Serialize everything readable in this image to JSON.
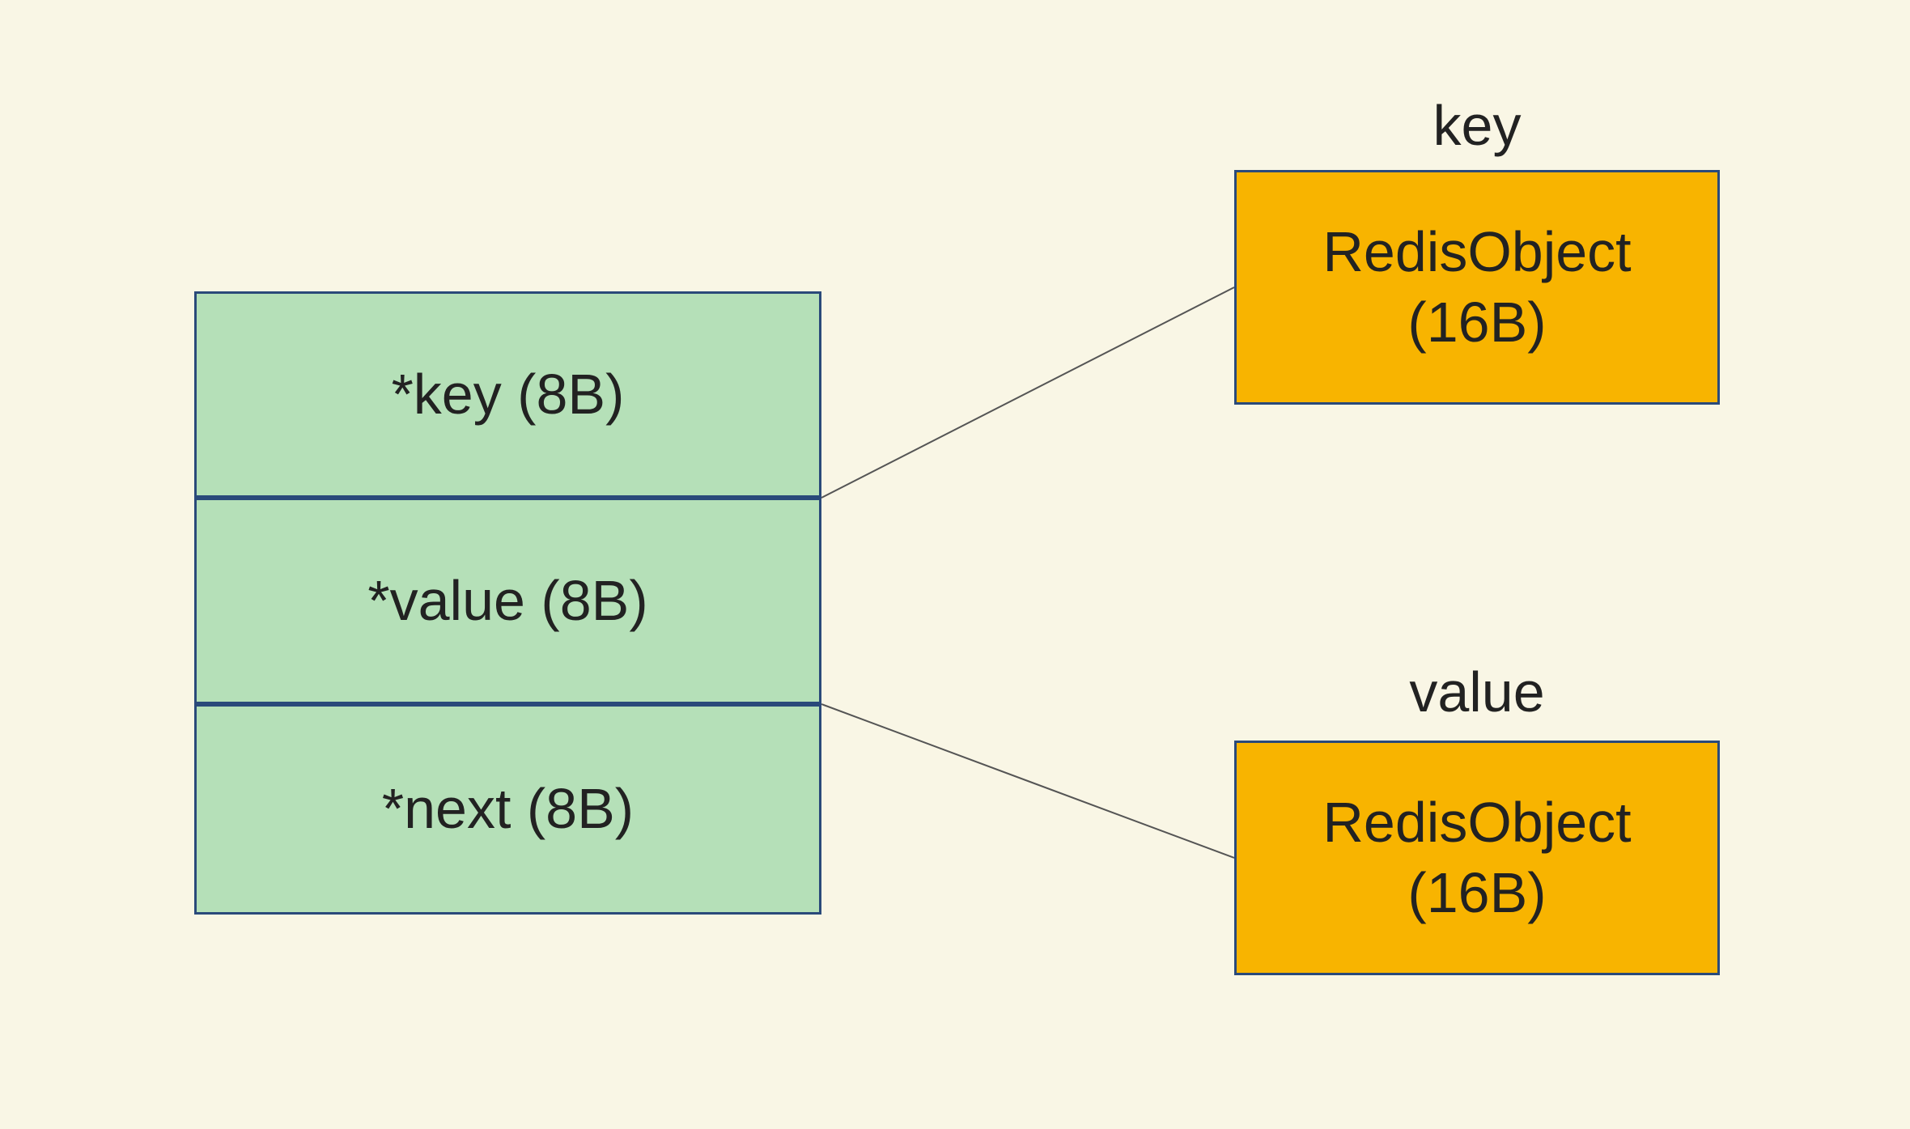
{
  "entry": {
    "key": "*key (8B)",
    "value": "*value (8B)",
    "next": "*next (8B)"
  },
  "objects": {
    "keyLabel": "key",
    "keyBox1": "RedisObject",
    "keyBox2": "(16B)",
    "valueLabel": "value",
    "valueBox1": "RedisObject",
    "valueBox2": "(16B)"
  },
  "colors": {
    "background": "#f9f6e5",
    "entryFill": "#b5e0b8",
    "objFill": "#f8b400",
    "border": "#2a4a7a"
  },
  "chart_data": {
    "type": "diagram",
    "title": "",
    "nodes": [
      {
        "id": "entry.key",
        "label": "*key (8B)",
        "group": "dictEntry",
        "size_bytes": 8
      },
      {
        "id": "entry.value",
        "label": "*value (8B)",
        "group": "dictEntry",
        "size_bytes": 8
      },
      {
        "id": "entry.next",
        "label": "*next (8B)",
        "group": "dictEntry",
        "size_bytes": 8
      },
      {
        "id": "obj.key",
        "label": "RedisObject (16B)",
        "group": "key",
        "size_bytes": 16
      },
      {
        "id": "obj.value",
        "label": "RedisObject (16B)",
        "group": "value",
        "size_bytes": 16
      }
    ],
    "edges": [
      {
        "from": "entry.key",
        "to": "obj.key"
      },
      {
        "from": "entry.value",
        "to": "obj.value"
      }
    ]
  }
}
